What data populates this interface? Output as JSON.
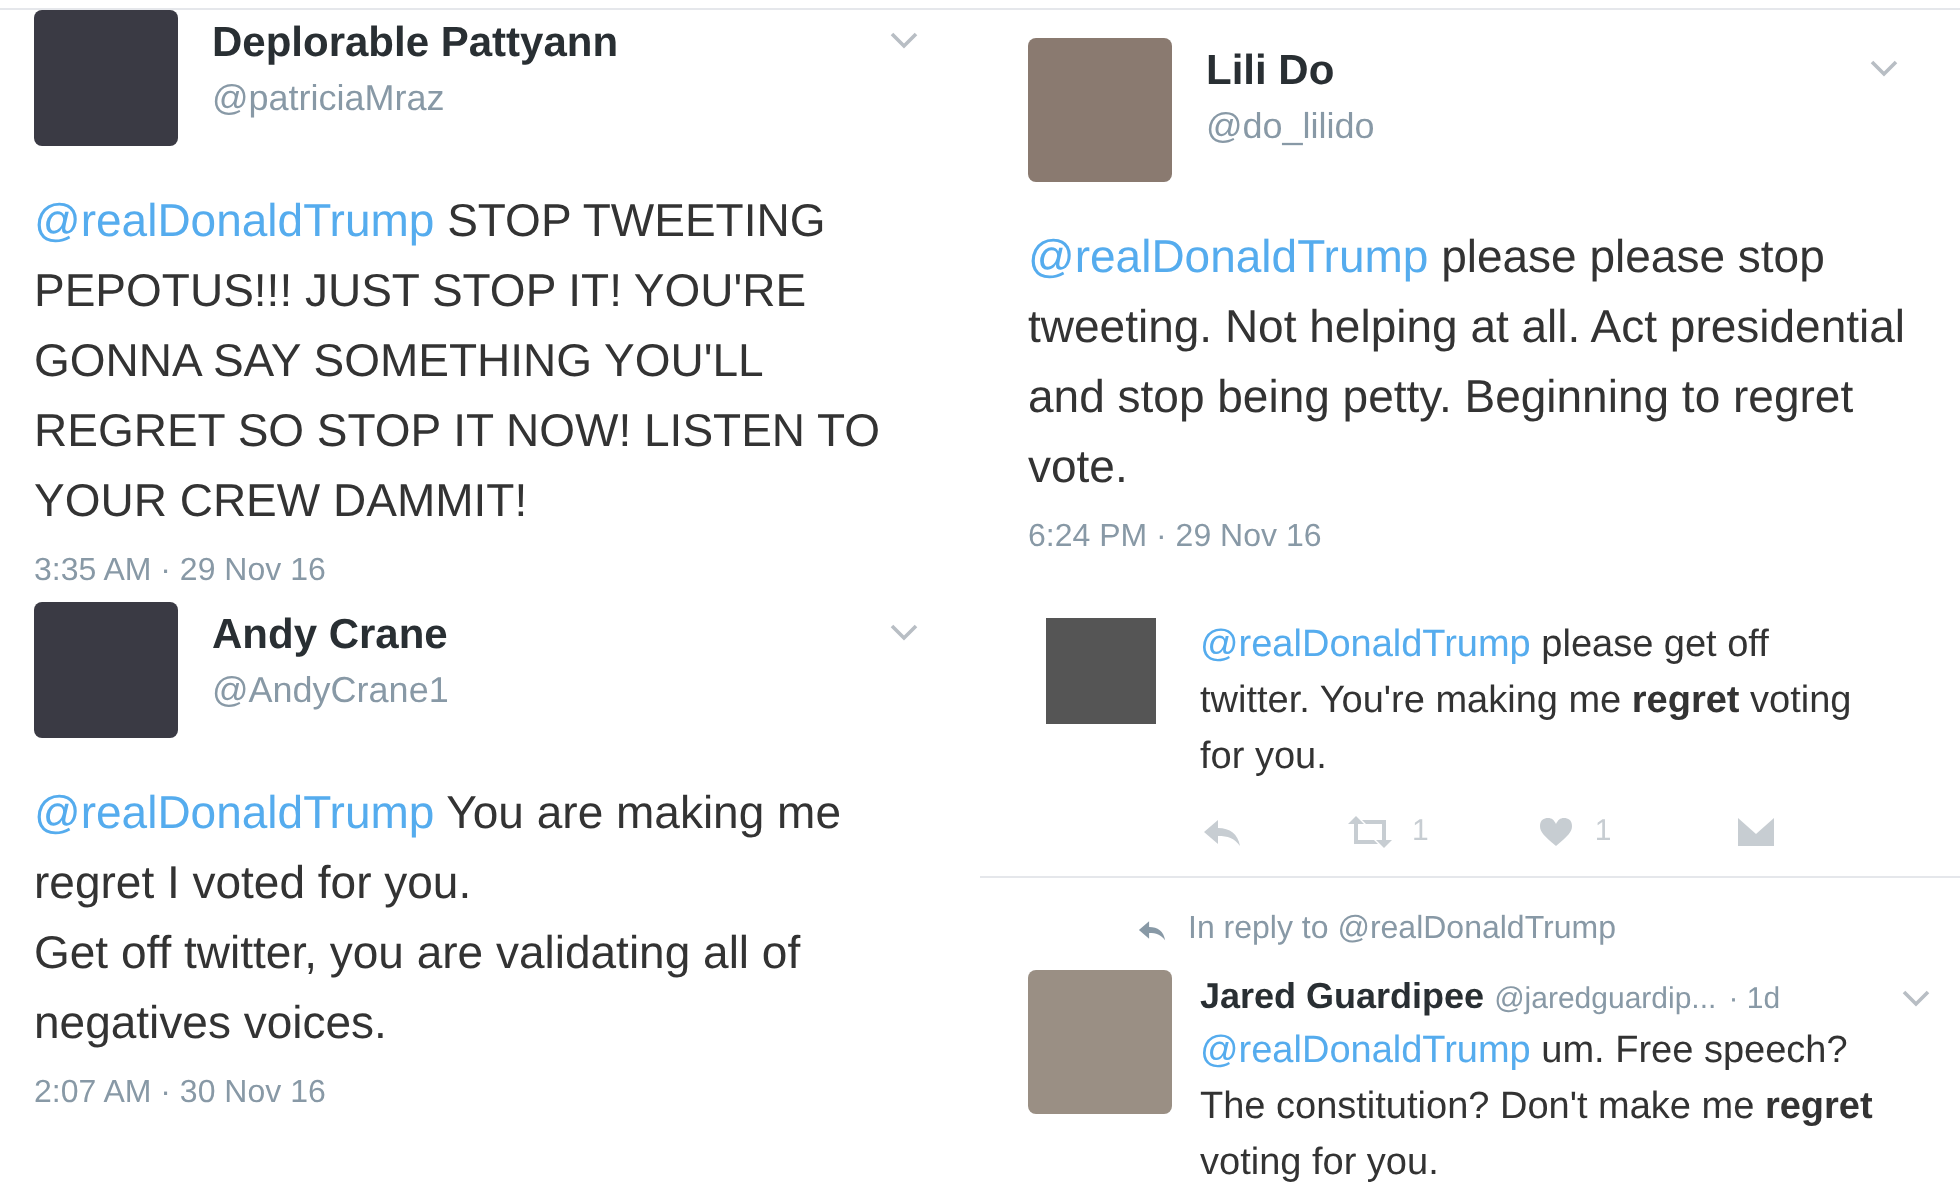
{
  "columns": [
    {
      "tweets": [
        {
          "kind": "full",
          "name": "Deplorable Pattyann",
          "handle": "@patriciaMraz",
          "mention": "@realDonaldTrump",
          "text": "STOP TWEETING PEPOTUS!!! JUST STOP IT! YOU'RE GONNA SAY SOMETHING YOU'LL REGRET SO STOP IT NOW! LISTEN TO YOUR CREW DAMMIT!",
          "time": "3:35 AM · 29 Nov 16"
        },
        {
          "kind": "full",
          "name": "Andy Crane",
          "handle": "@AndyCrane1",
          "mention": "@realDonaldTrump",
          "text": "You are making me regret I voted for you.\nGet off twitter, you are validating all of negatives voices.",
          "time": "2:07 AM · 30 Nov 16"
        }
      ]
    },
    {
      "tweets": [
        {
          "kind": "full",
          "name": "Lili Do",
          "handle": "@do_lilido",
          "mention": "@realDonaldTrump",
          "text": "please please stop tweeting. Not helping at all. Act presidential and stop being petty. Beginning to regret vote.",
          "time": "6:24 PM · 29 Nov 16"
        },
        {
          "kind": "reply",
          "mention": "@realDonaldTrump",
          "text": "please get off twitter. You're making me **regret** voting for you.",
          "retweets": "1",
          "likes": "1"
        },
        {
          "kind": "compact",
          "in_reply_to": "In reply to @realDonaldTrump",
          "name": "Jared Guardipee",
          "handle": "@jaredguardip...",
          "age": "· 1d",
          "mention": "@realDonaldTrump",
          "text": "um. Free speech? The constitution? Don't make me **regret** voting for you."
        }
      ]
    }
  ]
}
